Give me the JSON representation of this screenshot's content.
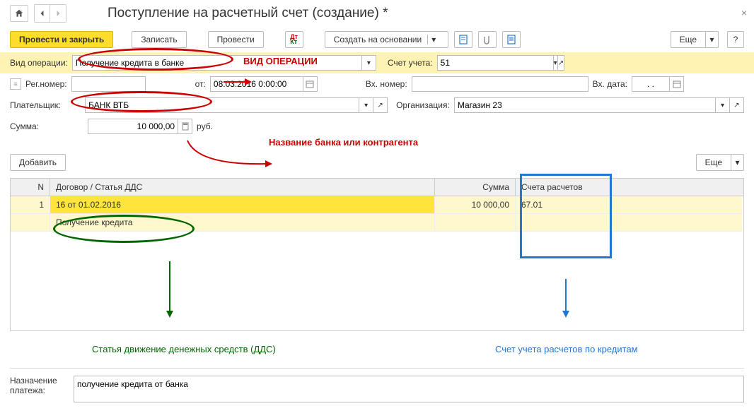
{
  "header": {
    "title": "Поступление на расчетный счет (создание) *"
  },
  "toolbar": {
    "post_close": "Провести и закрыть",
    "save": "Записать",
    "post": "Провести",
    "create_based": "Создать на основании",
    "more": "Еще"
  },
  "labels": {
    "operation_type": "Вид операции:",
    "account": "Счет учета:",
    "reg_no": "Рег.номер:",
    "from": "от:",
    "in_no": "Вх. номер:",
    "in_date": "Вх. дата:",
    "payer": "Плательщик:",
    "org": "Организация:",
    "sum": "Сумма:",
    "currency": "руб.",
    "add": "Добавить",
    "purpose": "Назначение платежа:"
  },
  "values": {
    "operation_type": "Получение кредита в банке",
    "account": "51",
    "date": "08.03.2016 0:00:00",
    "in_date": ". .",
    "payer": "БАНК ВТБ",
    "org": "Магазин 23",
    "sum": "10 000,00",
    "purpose": "получение кредита от банка"
  },
  "annotations": {
    "operation_type_note": "ВИД ОПЕРАЦИИ",
    "bank_note": "Название банка или контрагента",
    "dds_note": "Статья движение денежных средств (ДДС)",
    "acc_note": "Счет учета расчетов по кредитам"
  },
  "table": {
    "col_n": "N",
    "col_dds": "Договор / Статья ДДС",
    "col_sum": "Сумма",
    "col_acc": "Счета расчетов",
    "row_n": "1",
    "row_contract": "16 от 01.02.2016",
    "row_sum": "10 000,00",
    "row_acc": "67.01",
    "row_dds": "Получение кредита"
  }
}
